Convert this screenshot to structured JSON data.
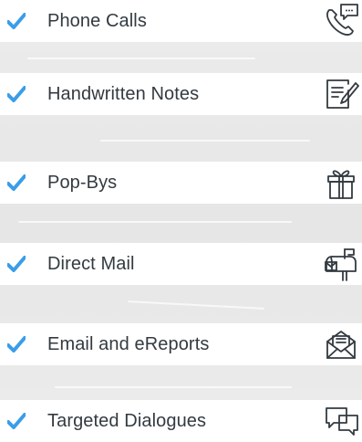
{
  "colors": {
    "check": "#3b9de8",
    "text": "#333a40",
    "icon": "#333a40",
    "row_background": "#ffffff",
    "page_background": "#e9e9e9"
  },
  "items": [
    {
      "label": "Phone Calls",
      "icon": "phone-chat-icon"
    },
    {
      "label": "Handwritten Notes",
      "icon": "note-pencil-icon"
    },
    {
      "label": "Pop-Bys",
      "icon": "gift-icon"
    },
    {
      "label": "Direct Mail",
      "icon": "mailbox-icon"
    },
    {
      "label": "Email and eReports",
      "icon": "envelope-letter-icon"
    },
    {
      "label": "Targeted Dialogues",
      "icon": "chat-bubbles-icon"
    }
  ]
}
